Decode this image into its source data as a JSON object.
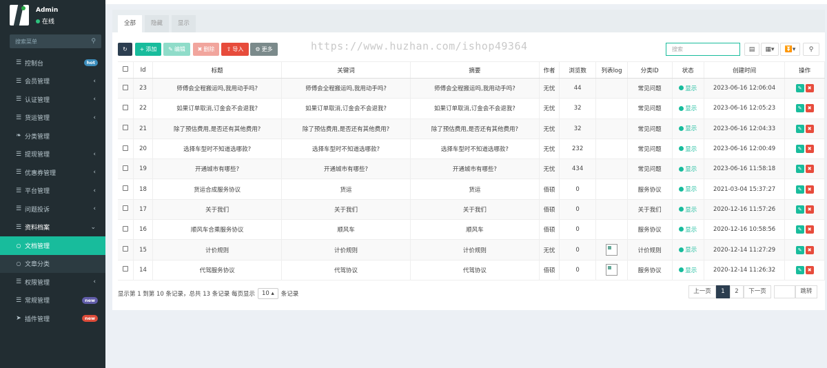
{
  "user": {
    "name": "Admin",
    "status": "在线"
  },
  "sidebar": {
    "search_placeholder": "搜索菜单",
    "items": [
      {
        "label": "控制台",
        "icon": "dashboard-icon",
        "badge": "hot",
        "badge_color": "#3c8dbc"
      },
      {
        "label": "会员管理",
        "icon": "list-icon",
        "has_arrow": true
      },
      {
        "label": "认证管理",
        "icon": "list-icon",
        "has_arrow": true
      },
      {
        "label": "货运管理",
        "icon": "list-icon",
        "has_arrow": true
      },
      {
        "label": "分类管理",
        "icon": "leaf-icon"
      },
      {
        "label": "提现管理",
        "icon": "list-icon",
        "has_arrow": true
      },
      {
        "label": "优惠券管理",
        "icon": "list-icon",
        "has_arrow": true
      },
      {
        "label": "平台管理",
        "icon": "list-icon",
        "has_arrow": true
      },
      {
        "label": "问题投诉",
        "icon": "list-icon",
        "has_arrow": true
      },
      {
        "label": "资料档案",
        "icon": "list-icon",
        "has_arrow": true,
        "open": true
      },
      {
        "label": "文档管理",
        "icon": "circle-icon",
        "sub": true,
        "active": true
      },
      {
        "label": "文章分类",
        "icon": "circle-icon",
        "sub": true
      },
      {
        "label": "权限管理",
        "icon": "list-icon",
        "has_arrow": true
      },
      {
        "label": "常规管理",
        "icon": "list-icon",
        "badge": "new",
        "badge_color": "#605ca8"
      },
      {
        "label": "插件管理",
        "icon": "rocket-icon",
        "badge": "new",
        "badge_color": "#dd4b39"
      }
    ]
  },
  "tabs": [
    "全部",
    "隐藏",
    "显示"
  ],
  "toolbar": {
    "refresh_icon": "refresh-icon",
    "add": "添加",
    "edit": "编辑",
    "delete": "删除",
    "import": "导入",
    "more": "更多",
    "search_placeholder": "搜索"
  },
  "watermark": "https://www.huzhan.com/ishop49364",
  "colors": {
    "accent": "#18bc9c",
    "danger": "#e74c3c",
    "dark": "#2c3e50",
    "sidebar": "#222d32"
  },
  "table": {
    "headers": [
      "Id",
      "标题",
      "关键词",
      "摘要",
      "作者",
      "浏览数",
      "列表log",
      "分类ID",
      "状态",
      "创建时间",
      "操作"
    ],
    "rows": [
      {
        "id": "23",
        "title": "师傅会全程搬运吗,我用动手吗?",
        "keywords": "师傅会全程搬运吗,我用动手吗?",
        "summary": "师傅会全程搬运吗,我用动手吗?",
        "author": "无忧",
        "views": "44",
        "logo": false,
        "category": "常见问题",
        "status": "显示",
        "created": "2023-06-16 12:06:04"
      },
      {
        "id": "22",
        "title": "如果订单取消,订金会不会退我?",
        "keywords": "如果订单取消,订金会不会退我?",
        "summary": "如果订单取消,订金会不会退我?",
        "author": "无忧",
        "views": "32",
        "logo": false,
        "category": "常见问题",
        "status": "显示",
        "created": "2023-06-16 12:05:23"
      },
      {
        "id": "21",
        "title": "除了预估费用,是否还有其他费用?",
        "keywords": "除了预估费用,是否还有其他费用?",
        "summary": "除了预估费用,是否还有其他费用?",
        "author": "无忧",
        "views": "32",
        "logo": false,
        "category": "常见问题",
        "status": "显示",
        "created": "2023-06-16 12:04:33"
      },
      {
        "id": "20",
        "title": "选择车型时不知道选哪款?",
        "keywords": "选择车型时不知道选哪款?",
        "summary": "选择车型时不知道选哪款?",
        "author": "无忧",
        "views": "232",
        "logo": false,
        "category": "常见问题",
        "status": "显示",
        "created": "2023-06-16 12:00:49"
      },
      {
        "id": "19",
        "title": "开通城市有哪些?",
        "keywords": "开通城市有哪些?",
        "summary": "开通城市有哪些?",
        "author": "无忧",
        "views": "434",
        "logo": false,
        "category": "常见问题",
        "status": "显示",
        "created": "2023-06-16 11:58:18"
      },
      {
        "id": "18",
        "title": "货运合成服务协议",
        "keywords": "货运",
        "summary": "货运",
        "author": "佰硕",
        "views": "0",
        "logo": false,
        "category": "服务协议",
        "status": "显示",
        "created": "2021-03-04 15:37:27"
      },
      {
        "id": "17",
        "title": "关于我们",
        "keywords": "关于我们",
        "summary": "关于我们",
        "author": "佰硕",
        "views": "0",
        "logo": false,
        "category": "关于我们",
        "status": "显示",
        "created": "2020-12-16 11:57:26"
      },
      {
        "id": "16",
        "title": "顺风车合乘服务协议",
        "keywords": "顺风车",
        "summary": "顺风车",
        "author": "佰硕",
        "views": "0",
        "logo": false,
        "category": "服务协议",
        "status": "显示",
        "created": "2020-12-16 10:58:56"
      },
      {
        "id": "15",
        "title": "计价规则",
        "keywords": "计价规则",
        "summary": "计价规则",
        "author": "无忧",
        "views": "0",
        "logo": true,
        "category": "计价规则",
        "status": "显示",
        "created": "2020-12-14 11:27:29"
      },
      {
        "id": "14",
        "title": "代驾服务协议",
        "keywords": "代驾协议",
        "summary": "代驾协议",
        "author": "佰硕",
        "views": "0",
        "logo": true,
        "category": "服务协议",
        "status": "显示",
        "created": "2020-12-14 11:26:32"
      }
    ]
  },
  "pagination": {
    "info_prefix": "显示第 1 到第 10 条记录，总共 13 条记录 每页显示",
    "page_size": "10",
    "info_suffix": "条记录",
    "prev": "上一页",
    "pages": [
      "1",
      "2"
    ],
    "current": "1",
    "next": "下一页",
    "jump": "跳转"
  }
}
